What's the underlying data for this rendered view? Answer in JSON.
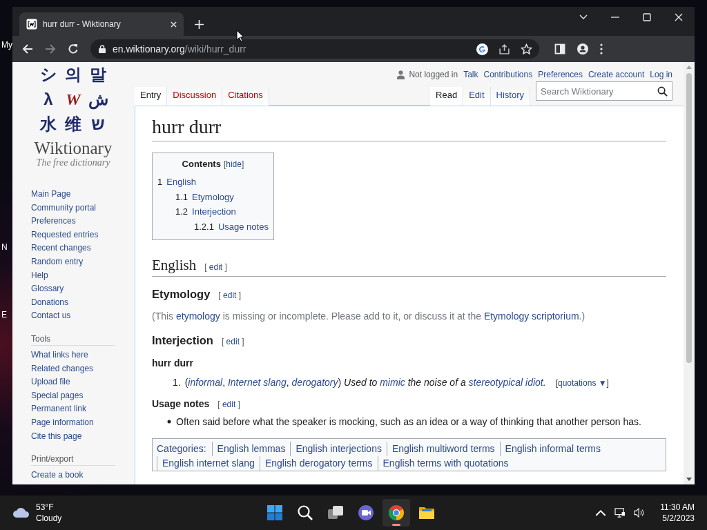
{
  "desktop": {
    "icon_labels": [
      "My",
      "N",
      "E"
    ]
  },
  "browser": {
    "tabs": [
      {
        "title": "hurr durr - Wiktionary",
        "selected": true
      }
    ],
    "url_host": "en.wiktionary.org",
    "url_path": "/wiki/hurr_durr"
  },
  "page": {
    "logo": {
      "glyphs": [
        "シ",
        "의",
        "말",
        "λ",
        "W",
        "ش",
        "水",
        "维",
        "ש"
      ],
      "name": "Wiktionary",
      "tagline": "The free dictionary"
    },
    "navigation": [
      "Main Page",
      "Community portal",
      "Preferences",
      "Requested entries",
      "Recent changes",
      "Random entry",
      "Help",
      "Glossary",
      "Donations",
      "Contact us"
    ],
    "sidebar_sections": [
      {
        "heading": "Tools",
        "items": [
          "What links here",
          "Related changes",
          "Upload file",
          "Special pages",
          "Permanent link",
          "Page information",
          "Cite this page"
        ]
      },
      {
        "heading": "Print/export",
        "items": [
          "Create a book"
        ]
      }
    ],
    "user_status": "Not logged in",
    "user_links": [
      "Talk",
      "Contributions",
      "Preferences",
      "Create account",
      "Log in"
    ],
    "namespace_tabs": [
      {
        "label": "Entry",
        "selected": true,
        "missing": false
      },
      {
        "label": "Discussion",
        "selected": false,
        "missing": true
      },
      {
        "label": "Citations",
        "selected": false,
        "missing": true
      }
    ],
    "view_tabs": [
      {
        "label": "Read",
        "selected": true
      },
      {
        "label": "Edit",
        "selected": false
      },
      {
        "label": "History",
        "selected": false
      }
    ],
    "search": {
      "placeholder": "Search Wiktionary"
    },
    "title": "hurr durr",
    "toc": {
      "title": "Contents",
      "toggle": [
        "[",
        "hide",
        "]"
      ],
      "items": [
        {
          "number": "1",
          "text": "English",
          "children": [
            {
              "number": "1.1",
              "text": "Etymology"
            },
            {
              "number": "1.2",
              "text": "Interjection",
              "children": [
                {
                  "number": "1.2.1",
                  "text": "Usage notes"
                }
              ]
            }
          ]
        }
      ]
    },
    "blocks": [
      {
        "kind": "h2",
        "text": "English",
        "edit": [
          "[",
          "edit",
          "]"
        ]
      },
      {
        "kind": "h3",
        "text": "Etymology",
        "edit": [
          "[",
          "edit",
          "]"
        ]
      },
      {
        "kind": "note",
        "segments": [
          {
            "text": "(This ",
            "link": false
          },
          {
            "text": "etymology",
            "link": true
          },
          {
            "text": " is missing or incomplete. Please add to it, or discuss it at the ",
            "link": false
          },
          {
            "text": "Etymology scriptorium",
            "link": true
          },
          {
            "text": ".)",
            "link": false
          }
        ]
      },
      {
        "kind": "h3",
        "text": "Interjection",
        "edit": [
          "[",
          "edit",
          "]"
        ]
      },
      {
        "kind": "headword",
        "text": "hurr durr"
      },
      {
        "kind": "definitions",
        "items": [
          {
            "number": "1.",
            "segments": [
              {
                "text": "(",
                "link": false,
                "italic": false
              },
              {
                "text": "informal",
                "link": true,
                "italic": true
              },
              {
                "text": ", ",
                "link": false,
                "italic": false
              },
              {
                "text": "Internet slang",
                "link": true,
                "italic": true
              },
              {
                "text": ", ",
                "link": false,
                "italic": false
              },
              {
                "text": "derogatory",
                "link": true,
                "italic": true
              },
              {
                "text": ")",
                "link": false,
                "italic": false
              },
              {
                "text": " Used to ",
                "link": false,
                "italic": true
              },
              {
                "text": "mimic",
                "link": true,
                "italic": true
              },
              {
                "text": " the noise of a ",
                "link": false,
                "italic": true
              },
              {
                "text": "stereotypical idiot",
                "link": true,
                "italic": true
              },
              {
                "text": ".",
                "link": false,
                "italic": true
              }
            ],
            "quotations": [
              "[",
              "quotations ▼",
              "]"
            ]
          }
        ]
      },
      {
        "kind": "h4",
        "text": "Usage notes",
        "edit": [
          "[",
          "edit",
          "]"
        ]
      },
      {
        "kind": "bullets",
        "items": [
          "Often said before what the speaker is mocking, such as an idea or a way of thinking that another person has."
        ]
      }
    ],
    "categories": {
      "label": "Categories:",
      "items": [
        "English lemmas",
        "English interjections",
        "English multiword terms",
        "English informal terms",
        "English internet slang",
        "English derogatory terms",
        "English terms with quotations"
      ]
    }
  },
  "taskbar": {
    "temperature": "53°F",
    "weather": "Cloudy",
    "apps": [
      {
        "kind": "start",
        "selected": false
      },
      {
        "kind": "search",
        "selected": false
      },
      {
        "kind": "taskview",
        "selected": false
      },
      {
        "kind": "chat",
        "selected": false
      },
      {
        "kind": "chrome",
        "selected": true
      },
      {
        "kind": "explorer",
        "selected": false
      }
    ],
    "time": "11:30 AM",
    "date": "5/2/2023"
  }
}
